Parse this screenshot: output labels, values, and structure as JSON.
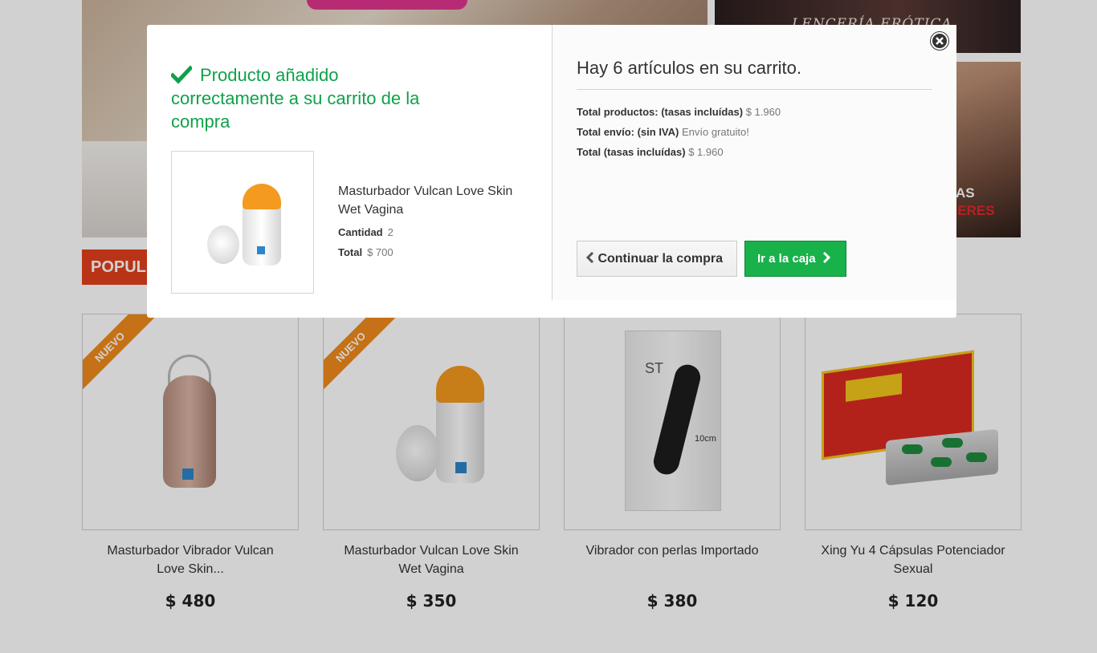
{
  "background": {
    "side_banner_top_text": "LENCERÍA ERÓTICA",
    "side_banner_bottom_line1": "AS",
    "side_banner_bottom_line2": "UERES",
    "section_tab": "POPUL",
    "products": [
      {
        "name_line1": "Masturbador Vibrador Vulcan",
        "name_line2": "Love Skin...",
        "price": "$ 480",
        "badge": "NUEVO"
      },
      {
        "name_line1": "Masturbador Vulcan Love Skin",
        "name_line2": "Wet Vagina",
        "price": "$ 350",
        "badge": "NUEVO"
      },
      {
        "name_line1": "Vibrador con perlas Importado",
        "name_line2": "",
        "price": "$ 380",
        "badge": ""
      },
      {
        "name_line1": "Xing Yu 4 Cápsulas Potenciador",
        "name_line2": "Sexual",
        "price": "$ 120",
        "badge": ""
      }
    ]
  },
  "modal": {
    "success_message": "Producto añadido correctamente a su carrito de la compra",
    "product": {
      "name": "Masturbador Vulcan Love Skin Wet Vagina",
      "quantity_label": "Cantidad",
      "quantity_value": "2",
      "total_label": "Total",
      "total_value": "$ 700"
    },
    "cart": {
      "title": "Hay 6 artículos en su carrito.",
      "products_label": "Total productos: (tasas incluídas)",
      "products_value": "$ 1.960",
      "shipping_label": "Total envío: (sin IVA)",
      "shipping_value": "Envío gratuito!",
      "total_label": "Total (tasas incluídas)",
      "total_value": "$ 1.960"
    },
    "continue_button": "Continuar la compra",
    "checkout_button": "Ir a la caja"
  },
  "colors": {
    "success_green": "#0fa14a",
    "checkout_green": "#18b14a",
    "section_red": "#e2401c",
    "badge_orange": "#f08a1d"
  },
  "icons": [
    "check-icon",
    "close-icon",
    "chevron-left-icon",
    "chevron-right-icon"
  ]
}
